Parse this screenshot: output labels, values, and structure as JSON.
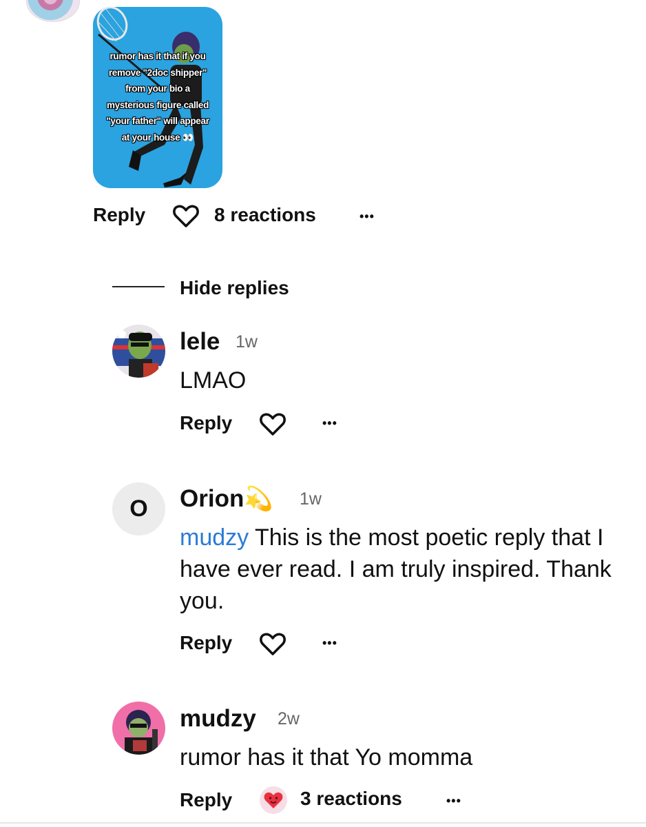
{
  "post": {
    "image_text_lines": [
      "rumor has it that if you",
      "remove \"2doc shipper\"",
      "from your bio a",
      "mysterious figure called",
      "\"your father\" will appear",
      "at your house"
    ],
    "reply_label": "Reply",
    "reactions_label": "8 reactions",
    "more_label": "•••"
  },
  "thread": {
    "hide_replies_label": "Hide replies"
  },
  "replies": [
    {
      "username": "lele",
      "time": "1w",
      "text": "LMAO",
      "reply_label": "Reply",
      "more_label": "•••"
    },
    {
      "avatar_letter": "O",
      "username": "Orion",
      "username_emoji": "💫",
      "time": "1w",
      "mention": "mudzy",
      "text": " This is the most poetic reply that I have ever read. I am truly inspired. Thank you.",
      "reply_label": "Reply",
      "more_label": "•••"
    },
    {
      "username": "mudzy",
      "time": "2w",
      "text": "rumor has it that Yo momma",
      "reply_label": "Reply",
      "reactions_label": "3 reactions",
      "reaction_emoji": "heart-face",
      "more_label": "•••"
    }
  ],
  "colors": {
    "mention": "#2b7bd6",
    "meme_bg": "#2aa3e0"
  }
}
